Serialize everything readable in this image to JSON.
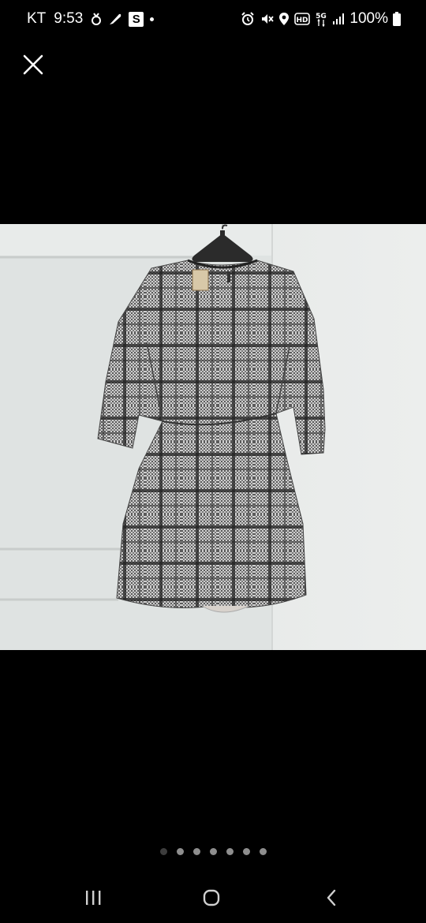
{
  "status_bar": {
    "carrier": "KT",
    "time": "9:53",
    "battery": "100%",
    "network": "5G",
    "hd_label": "HD"
  },
  "icons": {
    "close": "close-icon",
    "recents": "recents-icon",
    "home": "home-icon",
    "back": "back-icon"
  },
  "photo": {
    "subject": "plaid-dress-on-hanger",
    "colors": {
      "wall": "#e9ebea",
      "door": "#dfe2e1",
      "fabric_dark": "#2e2e2e",
      "fabric_light": "#b9b9b9"
    }
  },
  "pager": {
    "total": 7,
    "active_index": 0
  }
}
